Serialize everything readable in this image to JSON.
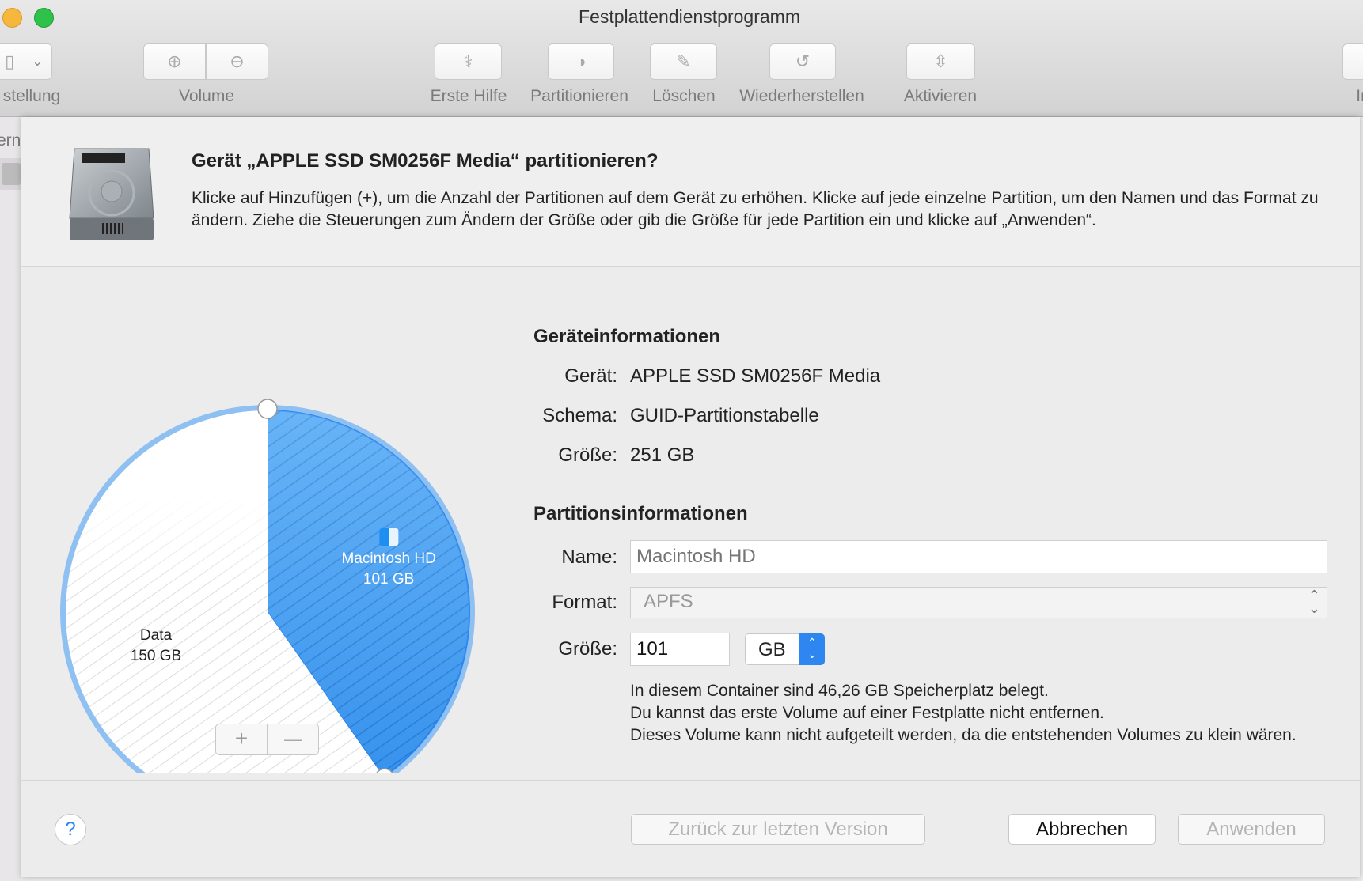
{
  "window": {
    "title": "Festplattendienstprogramm"
  },
  "toolbar": {
    "view_label": "Darstellung",
    "view_label_visible": "stellung",
    "volume_label": "Volume",
    "first_aid": "Erste Hilfe",
    "partition": "Partitionieren",
    "erase": "Löschen",
    "restore": "Wiederherstellen",
    "mount": "Aktivieren",
    "info_visible": "In"
  },
  "sidebar": {
    "section_visible": "ern"
  },
  "dialog": {
    "heading": "Gerät „APPLE SSD SM0256F Media“ partitionieren?",
    "description": "Klicke auf Hinzufügen (+), um die Anzahl der Partitionen auf dem Gerät zu erhöhen. Klicke auf jede einzelne Partition, um den Namen und das Format zu ändern. Ziehe die Steuerungen zum Ändern der Größe oder gib die Größe für jede Partition ein und klicke auf „Anwenden“.",
    "pie": {
      "partitions": [
        {
          "name": "Macintosh HD",
          "size": "101 GB",
          "value": 101,
          "selected": true
        },
        {
          "name": "Data",
          "size": "150 GB",
          "value": 150,
          "selected": false
        }
      ],
      "total": 251,
      "colors": {
        "selected": "#3a9bf0",
        "ring": "#8fc0f2"
      }
    },
    "add_label": "+",
    "remove_label": "—",
    "device_info": {
      "title": "Geräteinformationen",
      "rows": [
        {
          "label": "Gerät:",
          "value": "APPLE SSD SM0256F Media"
        },
        {
          "label": "Schema:",
          "value": "GUID-Partitionstabelle"
        },
        {
          "label": "Größe:",
          "value": "251 GB"
        }
      ]
    },
    "partition_info": {
      "title": "Partitionsinformationen",
      "name_label": "Name:",
      "name_placeholder": "Macintosh HD",
      "format_label": "Format:",
      "format_value": "APFS",
      "size_label": "Größe:",
      "size_value": "101",
      "unit_value": "GB"
    },
    "notes": [
      "In diesem Container sind 46,26 GB Speicherplatz belegt.",
      "Du kannst das erste Volume auf einer Festplatte nicht entfernen.",
      "Dieses Volume kann nicht aufgeteilt werden, da die entstehenden Volumes zu klein wären."
    ],
    "help_label": "?",
    "revert_label": "Zurück zur letzten Version",
    "cancel_label": "Abbrechen",
    "apply_label": "Anwenden"
  }
}
